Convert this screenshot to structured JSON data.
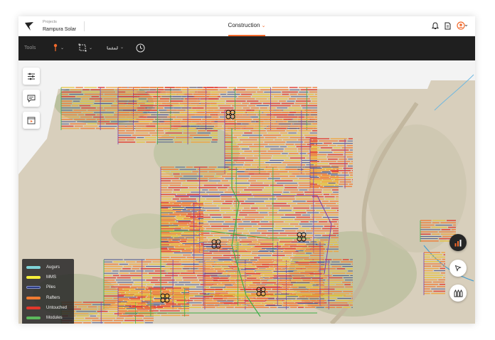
{
  "header": {
    "project_label": "Projects",
    "project_name": "Rampura Solar",
    "mode_label": "Construction",
    "mode_chevron": "⌄"
  },
  "toolbar": {
    "tools_label": "Tools"
  },
  "legend": {
    "items": [
      {
        "label": "Augurs",
        "color": "#7fd3d8"
      },
      {
        "label": "MMS",
        "color": "#f5ee3a"
      },
      {
        "label": "Piles",
        "color": "#2b3b86"
      },
      {
        "label": "Rafters",
        "color": "#f07b32"
      },
      {
        "label": "Untouched",
        "color": "#e2372b"
      },
      {
        "label": "Modules",
        "color": "#5cb85c"
      }
    ]
  },
  "colors": {
    "accent": "#f26a2c",
    "toolbar_bg": "#1f1f1f",
    "map_bg": "#dcd3c0"
  },
  "icons": {
    "logo": "kite-logo-icon",
    "bell": "bell-icon",
    "document": "document-icon",
    "avatar": "user-avatar-icon",
    "pin": "pin-tool-icon",
    "select": "select-area-icon",
    "measure": "ruler-icon",
    "clock": "clock-icon",
    "filters": "sliders-icon",
    "comments": "comment-icon",
    "media": "media-icon",
    "layers": "layers-icon",
    "progress": "bar-chart-icon",
    "pointer": "pointer-icon",
    "sectors": "drone-fleet-icon",
    "zoom_in": "zoom-in-icon",
    "zoom_out": "zoom-out-icon"
  }
}
